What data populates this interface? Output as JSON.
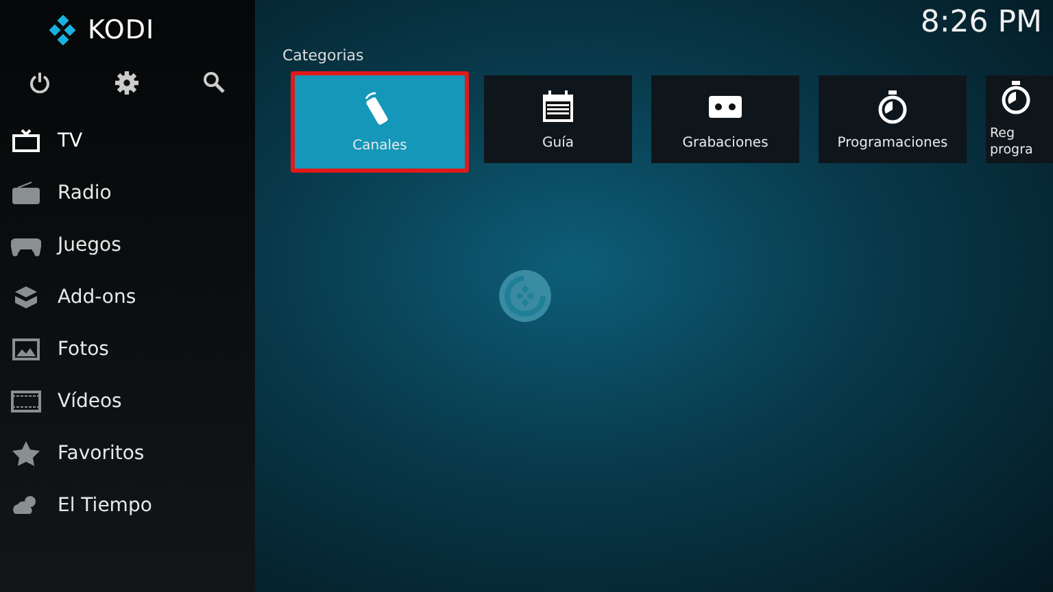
{
  "logo": {
    "text": "KODI"
  },
  "clock": "8:26 PM",
  "sidebar": {
    "items": [
      {
        "label": "TV",
        "selected": true
      },
      {
        "label": "Radio",
        "selected": false
      },
      {
        "label": "Juegos",
        "selected": false
      },
      {
        "label": "Add-ons",
        "selected": false
      },
      {
        "label": "Fotos",
        "selected": false
      },
      {
        "label": "Vídeos",
        "selected": false
      },
      {
        "label": "Favoritos",
        "selected": false
      },
      {
        "label": "El Tiempo",
        "selected": false
      }
    ]
  },
  "section_title": "Categorias",
  "tiles": [
    {
      "label": "Canales",
      "selected": true
    },
    {
      "label": "Guía",
      "selected": false
    },
    {
      "label": "Grabaciones",
      "selected": false
    },
    {
      "label": "Programaciones",
      "selected": false
    },
    {
      "label": "Reg progra",
      "selected": false
    }
  ]
}
